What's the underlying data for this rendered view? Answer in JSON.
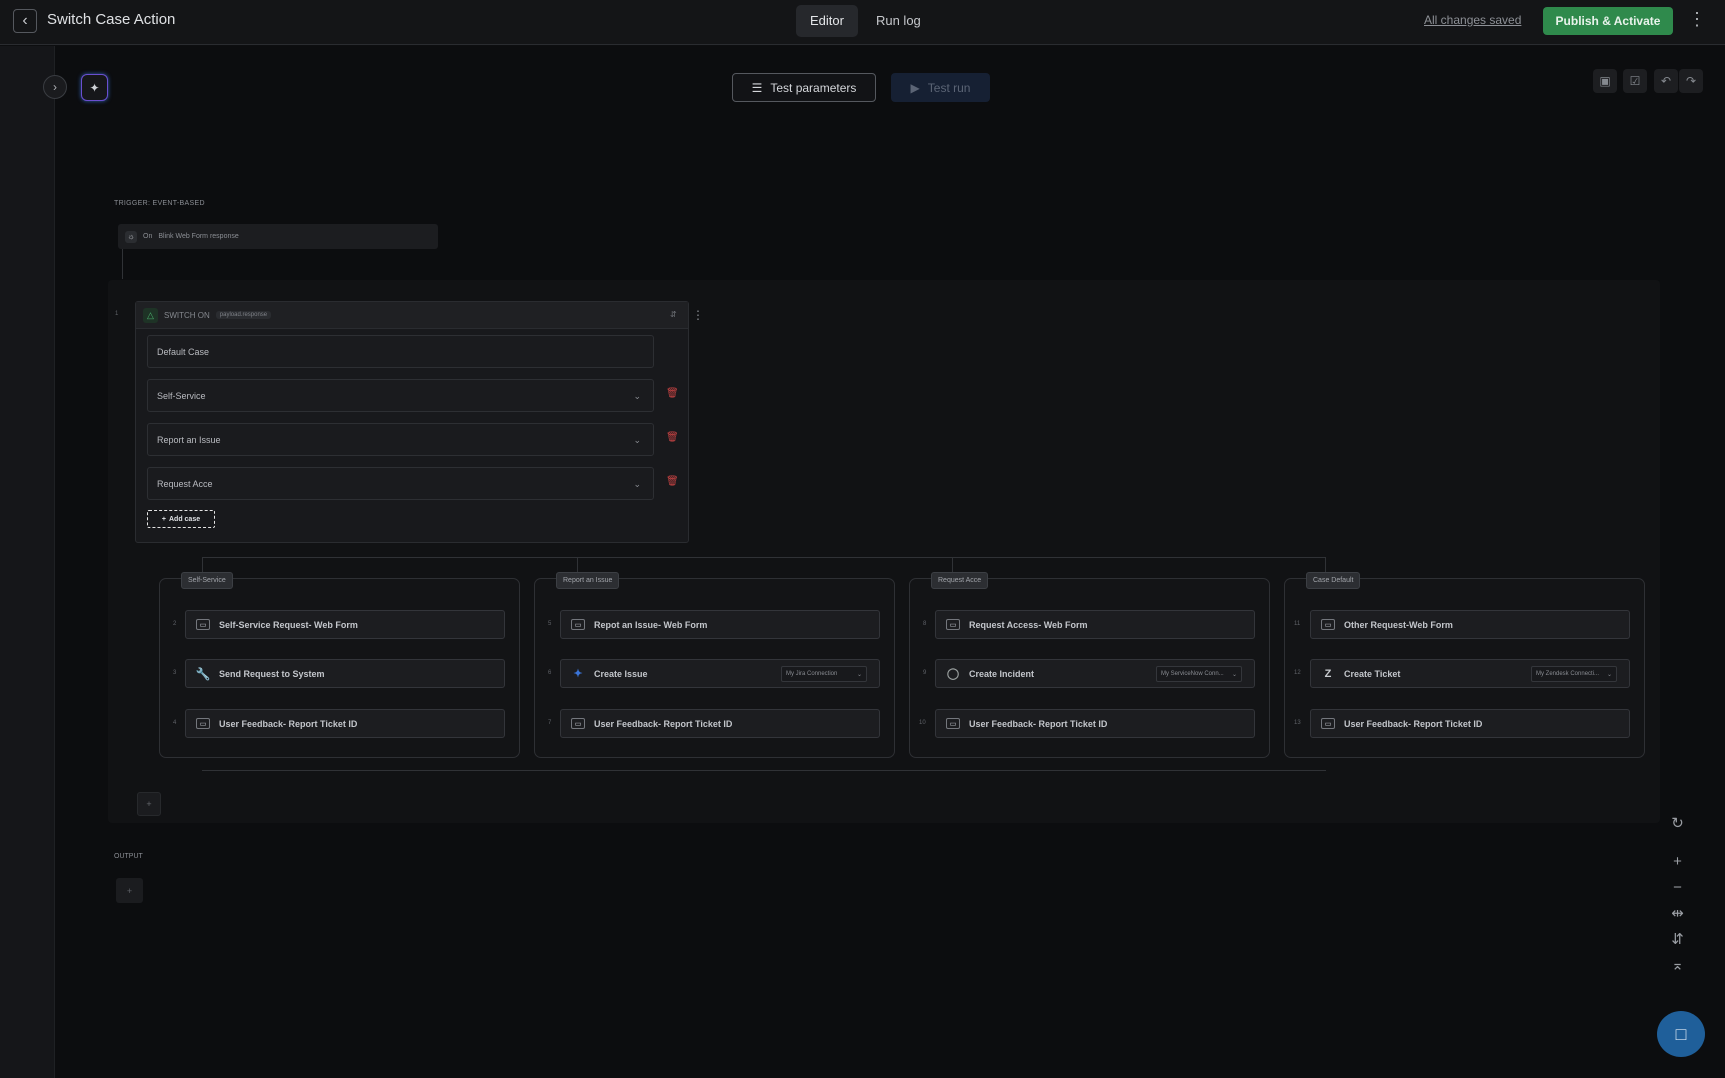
{
  "app": {
    "title": "Switch Case Action"
  },
  "header": {
    "tabs": [
      {
        "label": "Editor",
        "active": true
      },
      {
        "label": "Run log",
        "active": false
      }
    ],
    "saved_status": "All changes saved",
    "publish_label": "Publish & Activate"
  },
  "toolbar": {
    "test_params_label": "Test parameters",
    "test_run_label": "Test run"
  },
  "trigger": {
    "section_label": "TRIGGER: EVENT-BASED",
    "on_prefix": "On",
    "event": "Blink Web Form response"
  },
  "switch": {
    "step_number": "1",
    "title": "SWITCH ON",
    "param": "payload.response",
    "default_case": "Default Case",
    "cases": [
      "Self-Service",
      "Report an Issue",
      "Request Acce"
    ],
    "add_case_label": "Add case"
  },
  "lanes": [
    {
      "tag": "Self-Service",
      "nodes": [
        {
          "num": "2",
          "label": "Self-Service Request- Web Form",
          "icon": "form-icon"
        },
        {
          "num": "3",
          "label": "Send Request to System",
          "icon": "wrench-icon"
        },
        {
          "num": "4",
          "label": "User Feedback- Report Ticket ID",
          "icon": "form-icon"
        }
      ]
    },
    {
      "tag": "Report an Issue",
      "nodes": [
        {
          "num": "5",
          "label": "Repot an Issue- Web Form",
          "icon": "form-icon"
        },
        {
          "num": "6",
          "label": "Create Issue",
          "icon": "jira-icon",
          "connection": "My Jira Connection"
        },
        {
          "num": "7",
          "label": "User Feedback- Report Ticket ID",
          "icon": "form-icon"
        }
      ]
    },
    {
      "tag": "Request Acce",
      "nodes": [
        {
          "num": "8",
          "label": "Request Access- Web Form",
          "icon": "form-icon"
        },
        {
          "num": "9",
          "label": "Create Incident",
          "icon": "servicenow-icon",
          "connection": "My ServiceNow Conn..."
        },
        {
          "num": "10",
          "label": "User Feedback- Report Ticket ID",
          "icon": "form-icon"
        }
      ]
    },
    {
      "tag": "Case Default",
      "nodes": [
        {
          "num": "11",
          "label": "Other Request-Web Form",
          "icon": "form-icon"
        },
        {
          "num": "12",
          "label": "Create Ticket",
          "icon": "zendesk-icon",
          "connection": "My Zendesk Connecti..."
        },
        {
          "num": "13",
          "label": "User Feedback- Report Ticket ID",
          "icon": "form-icon"
        }
      ]
    }
  ],
  "output": {
    "label": "OUTPUT"
  },
  "colors": {
    "publish": "#2f8a4c",
    "delete": "#c74343",
    "ai_border": "#6b4fd0",
    "chat": "#1f5f9a"
  }
}
